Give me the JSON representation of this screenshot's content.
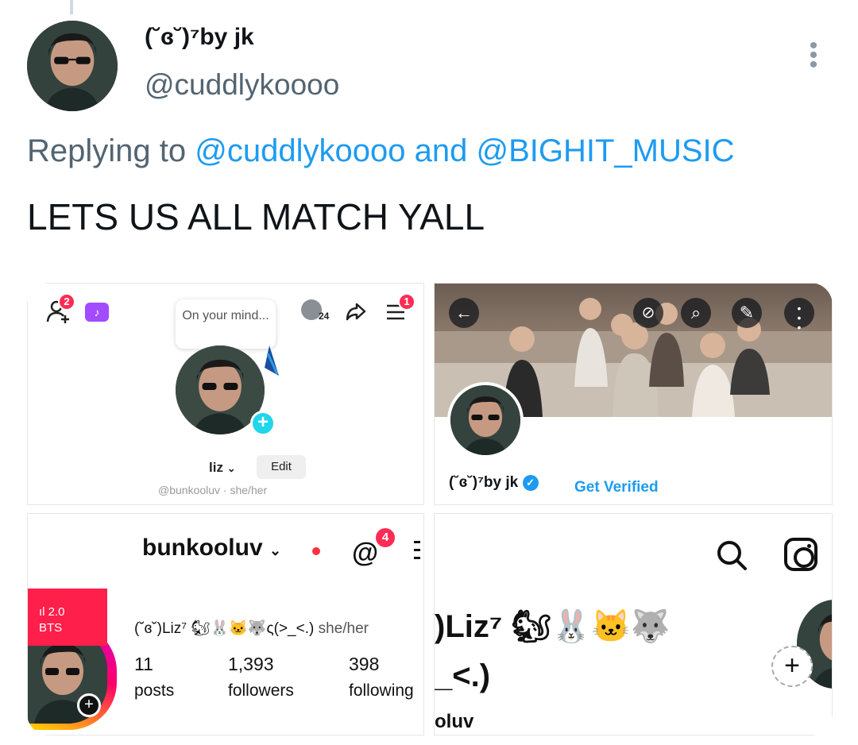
{
  "tweet": {
    "display_name": "(˘ɞ˘)⁷by jk",
    "handle": "@cuddlykoooo",
    "replying_prefix": "Replying to",
    "replying_mention_1": "@cuddlykoooo",
    "replying_and": "and",
    "replying_mention_2": "@BIGHIT_MUSIC",
    "text": "LETS US ALL MATCH YALL"
  },
  "tiktok": {
    "notif_count": "2",
    "stories_count": "24",
    "menu_count": "1",
    "bubble_text": "On your mind...",
    "name": "liz",
    "edit_label": "Edit",
    "subline": "@bunkooluv · she/her"
  },
  "twitter_profile": {
    "name": "(˘ɞ˘)⁷by jk",
    "get_verified": "Get Verified"
  },
  "instagram": {
    "username": "bunkooluv",
    "threads_count": "4",
    "note_line1": "ıl 2.0",
    "note_line2": "BTS",
    "bio": "(˘ɞ˘)Liz⁷ 🐿🐰🐱🐺ς(>_<.)",
    "pronouns": "she/her",
    "posts_num": "11",
    "posts_label": "posts",
    "followers_num": "1,393",
    "followers_label": "followers",
    "following_num": "398",
    "following_label": "following"
  },
  "profile4": {
    "line1": ")Liz⁷ 🐿🐰🐱🐺",
    "line2": "_<.)",
    "line3": "oluv"
  },
  "colors": {
    "accent": "#1d9bf0",
    "tiktok_red": "#fe2c55",
    "tiktok_cyan": "#20d5ec",
    "ig_note": "#ff1f4b"
  }
}
